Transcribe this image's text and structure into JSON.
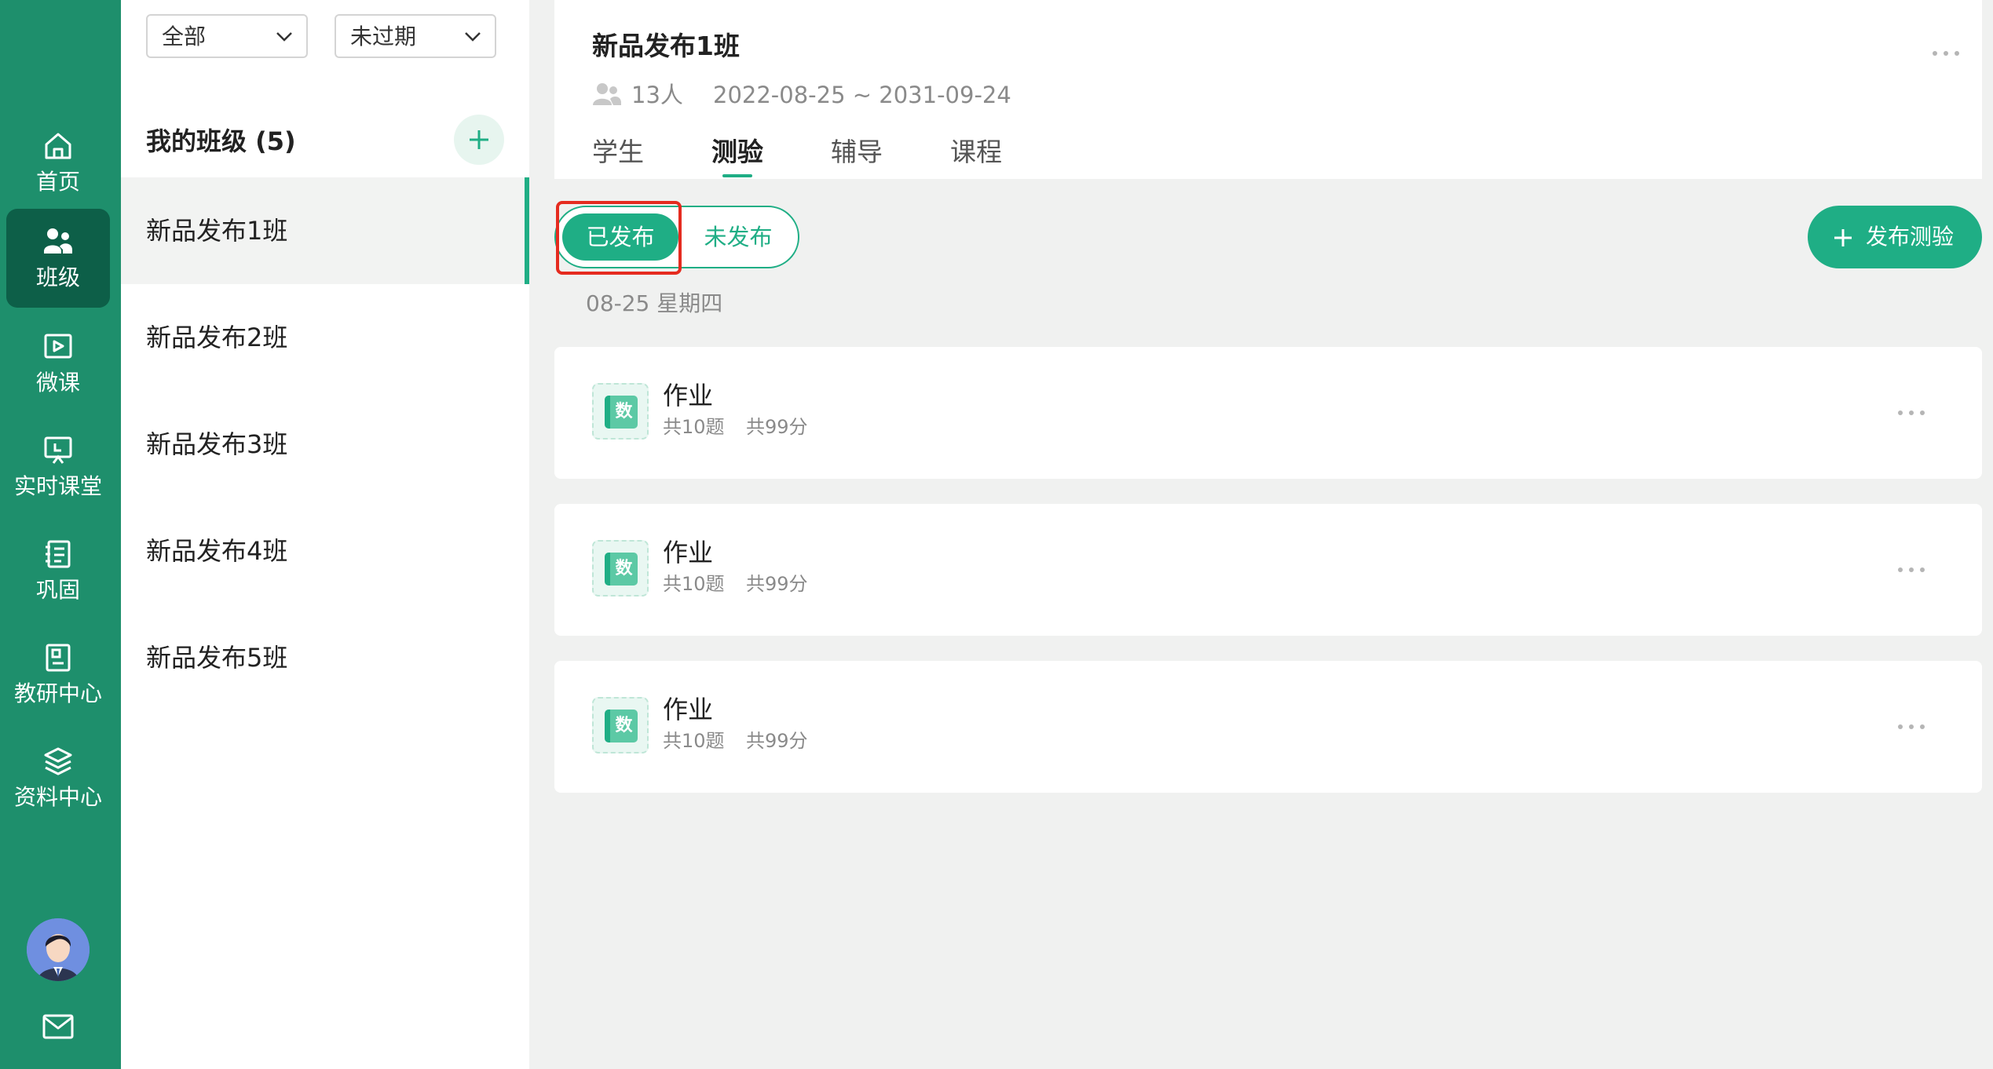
{
  "nav": {
    "items": [
      {
        "label": "首页",
        "icon": "home-icon"
      },
      {
        "label": "班级",
        "icon": "class-icon",
        "active": true
      },
      {
        "label": "微课",
        "icon": "micro-course-icon"
      },
      {
        "label": "实时课堂",
        "icon": "live-classroom-icon"
      },
      {
        "label": "巩固",
        "icon": "consolidate-icon"
      },
      {
        "label": "教研中心",
        "icon": "research-center-icon"
      },
      {
        "label": "资料中心",
        "icon": "resource-center-icon"
      }
    ],
    "avatar_icon": "user-avatar",
    "mail_icon": "mail-icon"
  },
  "filters": {
    "scope": "全部",
    "status": "未过期"
  },
  "class_list": {
    "title": "我的班级 (5)",
    "items": [
      "新品发布1班",
      "新品发布2班",
      "新品发布3班",
      "新品发布4班",
      "新品发布5班"
    ],
    "active_index": 0
  },
  "class_detail": {
    "title": "新品发布1班",
    "people": "13人",
    "date_range": "2022-08-25 ~ 2031-09-24",
    "tabs": [
      "学生",
      "测验",
      "辅导",
      "课程"
    ],
    "active_tab": 1
  },
  "quiz": {
    "segments": {
      "published": "已发布",
      "unpublished": "未发布"
    },
    "publish_button": "发布测验",
    "date_label": "08-25 星期四",
    "cards": [
      {
        "badge": "数",
        "title": "作业",
        "questions": "共10题",
        "score": "共99分"
      },
      {
        "badge": "数",
        "title": "作业",
        "questions": "共10题",
        "score": "共99分"
      },
      {
        "badge": "数",
        "title": "作业",
        "questions": "共10题",
        "score": "共99分"
      }
    ]
  },
  "colors": {
    "rail": "#1e8f6c",
    "rail_active": "#0d5f48",
    "accent": "#1fae85",
    "highlight_box": "#e52b1f"
  }
}
